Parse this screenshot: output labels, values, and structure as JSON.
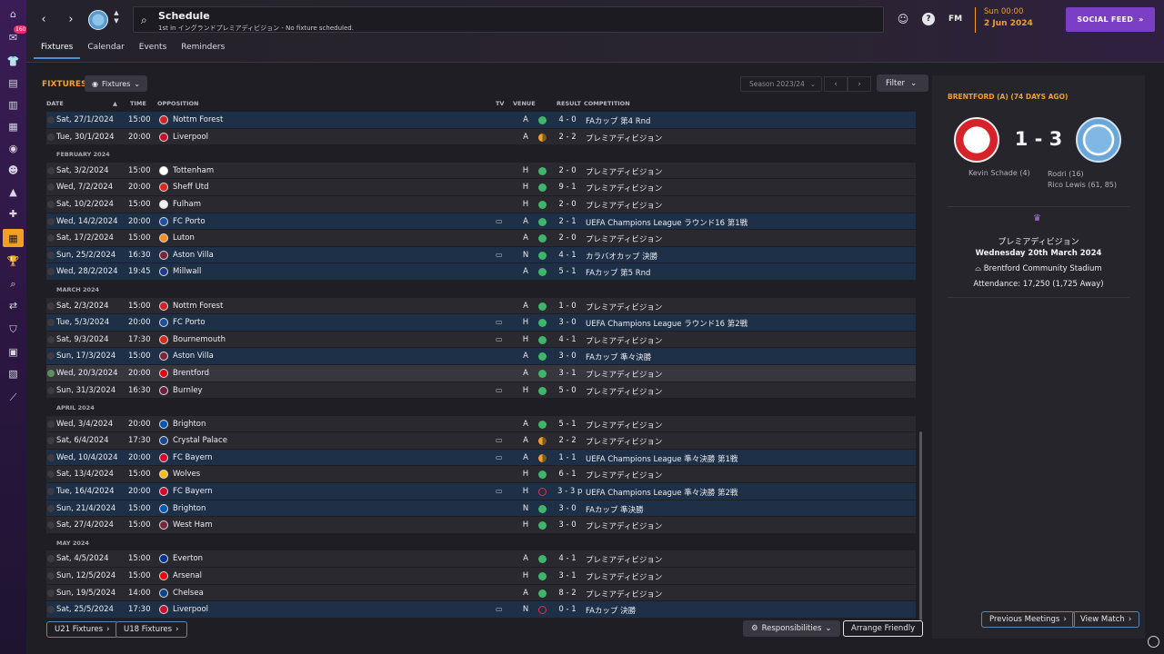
{
  "topbar": {
    "title": "Schedule",
    "subtitle": "1st in イングランドプレミアディビジョン - No fixture scheduled.",
    "fm_label": "FM",
    "date_time": "Sun 00:00",
    "date_date": "2 Jun 2024",
    "social_feed": "SOCIAL FEED",
    "tabs": [
      "Fixtures",
      "Calendar",
      "Events",
      "Reminders"
    ]
  },
  "rail": {
    "badge": "160"
  },
  "toolbar": {
    "fixtures_label": "FIXTURES",
    "fixtures_dropdown": "Fixtures",
    "season": "Season 2023/24",
    "filter": "Filter"
  },
  "columns": {
    "date": "DATE",
    "time": "TIME",
    "opposition": "OPPOSITION",
    "tv": "TV",
    "venue": "VENUE",
    "result": "RESULT",
    "competition": "COMPETITION"
  },
  "rows": [
    {
      "kind": "fx",
      "date": "Sat, 27/1/2024",
      "time": "15:00",
      "opp": "Nottm Forest",
      "crest": "#d21f2b",
      "tv": "",
      "venue": "A",
      "dot": "win",
      "res": "4 - 0",
      "comp": "FAカップ 第4 Rnd",
      "alt": true
    },
    {
      "kind": "fx",
      "date": "Tue, 30/1/2024",
      "time": "20:00",
      "opp": "Liverpool",
      "crest": "#c8102e",
      "tv": "",
      "venue": "A",
      "dot": "draw",
      "res": "2 - 2",
      "comp": "プレミアディビジョン"
    },
    {
      "kind": "month",
      "label": "FEBRUARY 2024"
    },
    {
      "kind": "fx",
      "date": "Sat, 3/2/2024",
      "time": "15:00",
      "opp": "Tottenham",
      "crest": "#ffffff",
      "tv": "",
      "venue": "H",
      "dot": "win",
      "res": "2 - 0",
      "comp": "プレミアディビジョン"
    },
    {
      "kind": "fx",
      "date": "Wed, 7/2/2024",
      "time": "20:00",
      "opp": "Sheff Utd",
      "crest": "#e2231a",
      "tv": "",
      "venue": "H",
      "dot": "win",
      "res": "9 - 1",
      "comp": "プレミアディビジョン"
    },
    {
      "kind": "fx",
      "date": "Sat, 10/2/2024",
      "time": "15:00",
      "opp": "Fulham",
      "crest": "#f0f0f0",
      "tv": "",
      "venue": "H",
      "dot": "win",
      "res": "2 - 0",
      "comp": "プレミアディビジョン"
    },
    {
      "kind": "fx",
      "date": "Wed, 14/2/2024",
      "time": "20:00",
      "opp": "FC Porto",
      "crest": "#1e4fa3",
      "tv": "tv",
      "venue": "A",
      "dot": "win",
      "res": "2 - 1",
      "comp": "UEFA Champions League ラウンド16 第1戦",
      "alt": true
    },
    {
      "kind": "fx",
      "date": "Sat, 17/2/2024",
      "time": "15:00",
      "opp": "Luton",
      "crest": "#f78f1e",
      "tv": "",
      "venue": "A",
      "dot": "win",
      "res": "2 - 0",
      "comp": "プレミアディビジョン"
    },
    {
      "kind": "fx",
      "date": "Sun, 25/2/2024",
      "time": "16:30",
      "opp": "Aston Villa",
      "crest": "#7a263a",
      "tv": "tv",
      "venue": "N",
      "dot": "win",
      "res": "4 - 1",
      "comp": "カラバオカップ 決勝",
      "alt": true
    },
    {
      "kind": "fx",
      "date": "Wed, 28/2/2024",
      "time": "19:45",
      "opp": "Millwall",
      "crest": "#1d3c8f",
      "tv": "",
      "venue": "A",
      "dot": "win",
      "res": "5 - 1",
      "comp": "FAカップ 第5 Rnd",
      "alt": true
    },
    {
      "kind": "month",
      "label": "MARCH 2024"
    },
    {
      "kind": "fx",
      "date": "Sat, 2/3/2024",
      "time": "15:00",
      "opp": "Nottm Forest",
      "crest": "#d21f2b",
      "tv": "",
      "venue": "A",
      "dot": "win",
      "res": "1 - 0",
      "comp": "プレミアディビジョン"
    },
    {
      "kind": "fx",
      "date": "Tue, 5/3/2024",
      "time": "20:00",
      "opp": "FC Porto",
      "crest": "#1e4fa3",
      "tv": "tv",
      "venue": "H",
      "dot": "win",
      "res": "3 - 0",
      "comp": "UEFA Champions League ラウンド16 第2戦",
      "alt": true
    },
    {
      "kind": "fx",
      "date": "Sat, 9/3/2024",
      "time": "17:30",
      "opp": "Bournemouth",
      "crest": "#da291c",
      "tv": "tv",
      "venue": "H",
      "dot": "win",
      "res": "4 - 1",
      "comp": "プレミアディビジョン"
    },
    {
      "kind": "fx",
      "date": "Sun, 17/3/2024",
      "time": "15:00",
      "opp": "Aston Villa",
      "crest": "#7a263a",
      "tv": "",
      "venue": "A",
      "dot": "win",
      "res": "3 - 0",
      "comp": "FAカップ 準々決勝",
      "alt": true
    },
    {
      "kind": "fx",
      "date": "Wed, 20/3/2024",
      "time": "20:00",
      "opp": "Brentford",
      "crest": "#e30613",
      "tv": "",
      "venue": "A",
      "dot": "win",
      "res": "3 - 1",
      "comp": "プレミアディビジョン",
      "sel": true
    },
    {
      "kind": "fx",
      "date": "Sun, 31/3/2024",
      "time": "16:30",
      "opp": "Burnley",
      "crest": "#6c1d45",
      "tv": "tv",
      "venue": "H",
      "dot": "win",
      "res": "5 - 0",
      "comp": "プレミアディビジョン"
    },
    {
      "kind": "month",
      "label": "APRIL 2024"
    },
    {
      "kind": "fx",
      "date": "Wed, 3/4/2024",
      "time": "20:00",
      "opp": "Brighton",
      "crest": "#0057b8",
      "tv": "",
      "venue": "A",
      "dot": "win",
      "res": "5 - 1",
      "comp": "プレミアディビジョン"
    },
    {
      "kind": "fx",
      "date": "Sat, 6/4/2024",
      "time": "17:30",
      "opp": "Crystal Palace",
      "crest": "#1b458f",
      "tv": "tv",
      "venue": "A",
      "dot": "draw",
      "res": "2 - 2",
      "comp": "プレミアディビジョン"
    },
    {
      "kind": "fx",
      "date": "Wed, 10/4/2024",
      "time": "20:00",
      "opp": "FC Bayern",
      "crest": "#dc052d",
      "tv": "tv",
      "venue": "A",
      "dot": "draw",
      "res": "1 - 1",
      "comp": "UEFA Champions League 準々決勝 第1戦",
      "alt": true
    },
    {
      "kind": "fx",
      "date": "Sat, 13/4/2024",
      "time": "15:00",
      "opp": "Wolves",
      "crest": "#fdb913",
      "tv": "",
      "venue": "H",
      "dot": "win",
      "res": "6 - 1",
      "comp": "プレミアディビジョン"
    },
    {
      "kind": "fx",
      "date": "Tue, 16/4/2024",
      "time": "20:00",
      "opp": "FC Bayern",
      "crest": "#dc052d",
      "tv": "tv",
      "venue": "H",
      "dot": "loss",
      "res": "3 - 3 p",
      "comp": "UEFA Champions League 準々決勝 第2戦",
      "alt": true
    },
    {
      "kind": "fx",
      "date": "Sun, 21/4/2024",
      "time": "15:00",
      "opp": "Brighton",
      "crest": "#0057b8",
      "tv": "",
      "venue": "N",
      "dot": "win",
      "res": "3 - 0",
      "comp": "FAカップ 準決勝",
      "alt": true
    },
    {
      "kind": "fx",
      "date": "Sat, 27/4/2024",
      "time": "15:00",
      "opp": "West Ham",
      "crest": "#7a263a",
      "tv": "",
      "venue": "H",
      "dot": "win",
      "res": "3 - 0",
      "comp": "プレミアディビジョン"
    },
    {
      "kind": "month",
      "label": "MAY 2024"
    },
    {
      "kind": "fx",
      "date": "Sat, 4/5/2024",
      "time": "15:00",
      "opp": "Everton",
      "crest": "#003399",
      "tv": "",
      "venue": "A",
      "dot": "win",
      "res": "4 - 1",
      "comp": "プレミアディビジョン"
    },
    {
      "kind": "fx",
      "date": "Sun, 12/5/2024",
      "time": "15:00",
      "opp": "Arsenal",
      "crest": "#ef0107",
      "tv": "",
      "venue": "H",
      "dot": "win",
      "res": "3 - 1",
      "comp": "プレミアディビジョン"
    },
    {
      "kind": "fx",
      "date": "Sun, 19/5/2024",
      "time": "14:00",
      "opp": "Chelsea",
      "crest": "#034694",
      "tv": "",
      "venue": "A",
      "dot": "win",
      "res": "8 - 2",
      "comp": "プレミアディビジョン"
    },
    {
      "kind": "fx",
      "date": "Sat, 25/5/2024",
      "time": "17:30",
      "opp": "Liverpool",
      "crest": "#c8102e",
      "tv": "tv",
      "venue": "N",
      "dot": "loss",
      "res": "0 - 1",
      "comp": "FAカップ 決勝",
      "alt": true
    }
  ],
  "bottom": {
    "u21": "U21 Fixtures",
    "u18": "U18 Fixtures",
    "responsibilities": "Responsibilities",
    "arrange": "Arrange Friendly"
  },
  "match": {
    "title": "BRENTFORD (A) (74 DAYS AGO)",
    "score": "1 - 3",
    "scorer_home": "Kevin Schade (4)",
    "scorer_away_1": "Rodri (16)",
    "scorer_away_2": "Rico Lewis (61, 85)",
    "competition": "プレミアディビジョン",
    "date": "Wednesday 20th March 2024",
    "stadium": "Brentford Community Stadium",
    "attendance": "Attendance: 17,250 (1,725 Away)",
    "previous_meetings": "Previous Meetings",
    "view_match": "View Match"
  },
  "colors": {
    "accent": "#f2a023",
    "win": "#3fb56b",
    "draw": "#f2a023",
    "loss": "#e0304a",
    "social": "#7b3fc6"
  }
}
